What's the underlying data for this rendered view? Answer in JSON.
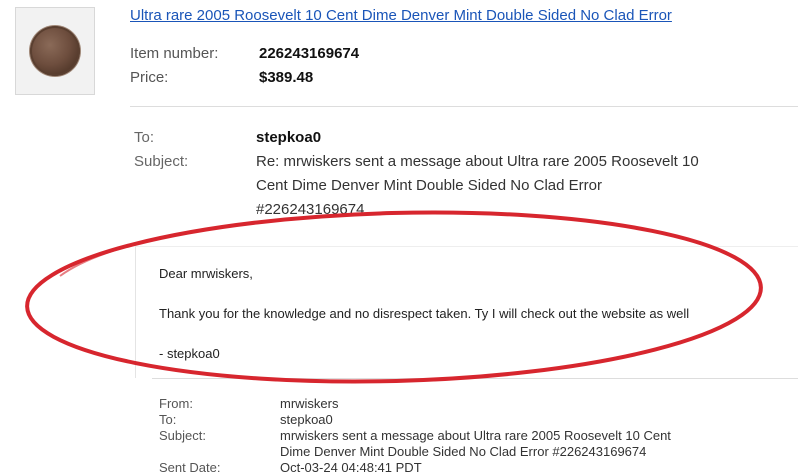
{
  "item": {
    "title": "Ultra rare 2005 Roosevelt 10 Cent Dime Denver Mint Double Sided No Clad Error",
    "number_label": "Item number:",
    "number": "226243169674",
    "price_label": "Price:",
    "price": "$389.48"
  },
  "reply": {
    "to_label": "To:",
    "to": "stepkoa0",
    "subject_label": "Subject:",
    "subject_line1": "Re: mrwiskers sent a message about Ultra rare 2005 Roosevelt 10",
    "subject_line2": "Cent Dime Denver Mint Double Sided No Clad Error",
    "subject_line3": "#226243169674"
  },
  "message": {
    "greeting": "Dear mrwiskers,",
    "body": "Thank you for the knowledge and no disrespect taken. Ty I will check out the website as well",
    "signoff": "- stepkoa0"
  },
  "original": {
    "from_label": "From:",
    "from": "mrwiskers",
    "to_label": "To:",
    "to": "stepkoa0",
    "subject_label": "Subject:",
    "subject_line1": "mrwiskers sent a message about Ultra rare 2005 Roosevelt 10 Cent",
    "subject_line2": "Dime Denver Mint Double Sided No Clad Error #226243169674",
    "date_label": "Sent Date:",
    "date": "Oct-03-24 04:48:41 PDT"
  },
  "colors": {
    "link": "#1a55b8",
    "annotation": "#d7262e"
  }
}
